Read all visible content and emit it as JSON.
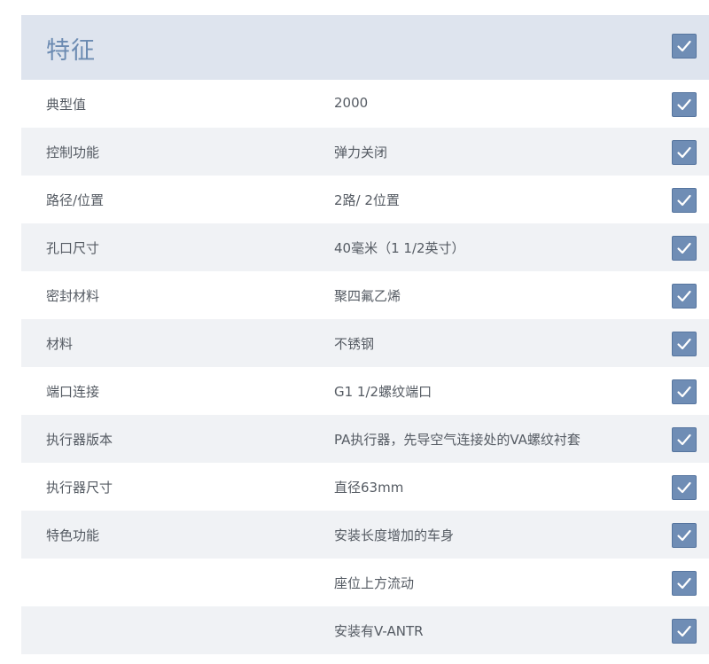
{
  "header": {
    "title": "特征",
    "checked": true
  },
  "rows": [
    {
      "label": "典型值",
      "value": "2000",
      "checked": true
    },
    {
      "label": "控制功能",
      "value": "弹力关闭",
      "checked": true
    },
    {
      "label": "路径/位置",
      "value": "2路/ 2位置",
      "checked": true
    },
    {
      "label": "孔口尺寸",
      "value": "40毫米（1 1/2英寸）",
      "checked": true
    },
    {
      "label": "密封材料",
      "value": "聚四氟乙烯",
      "checked": true
    },
    {
      "label": "材料",
      "value": "不锈钢",
      "checked": true
    },
    {
      "label": "端口连接",
      "value": "G1 1/2螺纹端口",
      "checked": true
    },
    {
      "label": "执行器版本",
      "value": "PA执行器，先导空气连接处的VA螺纹衬套",
      "checked": true
    },
    {
      "label": "执行器尺寸",
      "value": "直径63mm",
      "checked": true
    },
    {
      "label": "特色功能",
      "value": "安装长度增加的车身",
      "checked": true
    },
    {
      "label": "",
      "value": "座位上方流动",
      "checked": true
    },
    {
      "label": "",
      "value": "安装有V-ANTR",
      "checked": true
    }
  ],
  "icons": {
    "checkbox": "checkmark-icon"
  },
  "colors": {
    "header_bg": "#dee4ee",
    "title": "#6c8bb2",
    "check_bg": "#6f8db5",
    "stripe": "#f0f2f5"
  }
}
